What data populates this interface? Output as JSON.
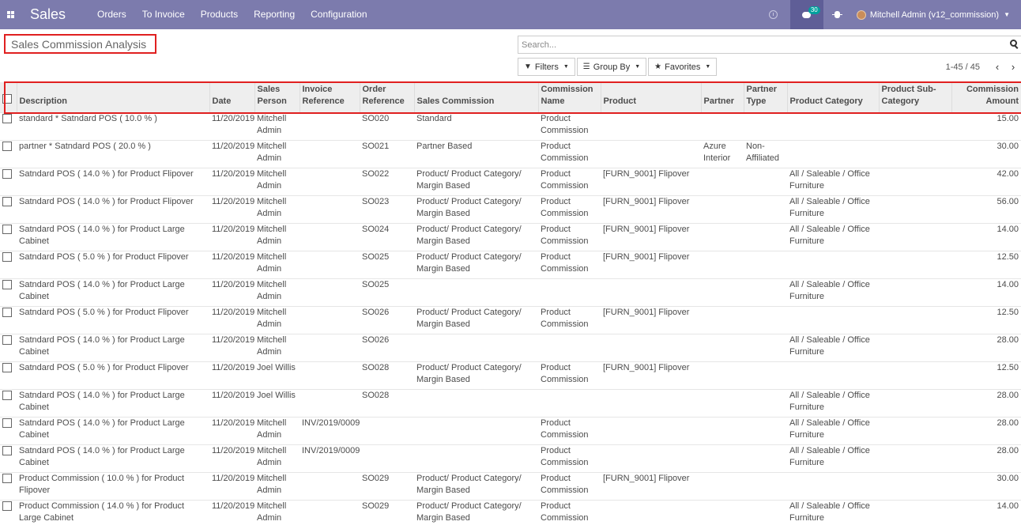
{
  "navbar": {
    "brand": "Sales",
    "menu": [
      "Orders",
      "To Invoice",
      "Products",
      "Reporting",
      "Configuration"
    ],
    "messages_badge": "30",
    "user": "Mitchell Admin (v12_commission)"
  },
  "page": {
    "title": "Sales Commission Analysis",
    "search_placeholder": "Search...",
    "filters_label": "Filters",
    "groupby_label": "Group By",
    "favorites_label": "Favorites",
    "pager": "1-45 / 45"
  },
  "table": {
    "columns": [
      "Description",
      "Date",
      "Sales Person",
      "Invoice Reference",
      "Order Reference",
      "Sales Commission",
      "Commission Name",
      "Product",
      "Partner",
      "Partner Type",
      "Product Category",
      "Product Sub-Category",
      "Commission Amount"
    ],
    "rows": [
      {
        "description": "standard * Satndard POS ( 10.0 % )",
        "date": "11/20/2019",
        "salesperson": "Mitchell Admin",
        "invoice": "",
        "order": "SO020",
        "commission": "Standard",
        "name": "Product Commission",
        "product": "",
        "partner": "",
        "partner_type": "",
        "category": "",
        "subcategory": "",
        "amount": "15.00"
      },
      {
        "description": "partner * Satndard POS ( 20.0 % )",
        "date": "11/20/2019",
        "salesperson": "Mitchell Admin",
        "invoice": "",
        "order": "SO021",
        "commission": "Partner Based",
        "name": "Product Commission",
        "product": "",
        "partner": "Azure Interior",
        "partner_type": "Non-Affiliated",
        "category": "",
        "subcategory": "",
        "amount": "30.00"
      },
      {
        "description": "Satndard POS ( 14.0 % ) for Product Flipover",
        "date": "11/20/2019",
        "salesperson": "Mitchell Admin",
        "invoice": "",
        "order": "SO022",
        "commission": "Product/ Product Category/ Margin Based",
        "name": "Product Commission",
        "product": "[FURN_9001] Flipover",
        "partner": "",
        "partner_type": "",
        "category": "All / Saleable / Office Furniture",
        "subcategory": "",
        "amount": "42.00"
      },
      {
        "description": "Satndard POS ( 14.0 % ) for Product Flipover",
        "date": "11/20/2019",
        "salesperson": "Mitchell Admin",
        "invoice": "",
        "order": "SO023",
        "commission": "Product/ Product Category/ Margin Based",
        "name": "Product Commission",
        "product": "[FURN_9001] Flipover",
        "partner": "",
        "partner_type": "",
        "category": "All / Saleable / Office Furniture",
        "subcategory": "",
        "amount": "56.00"
      },
      {
        "description": "Satndard POS ( 14.0 % ) for Product Large Cabinet",
        "date": "11/20/2019",
        "salesperson": "Mitchell Admin",
        "invoice": "",
        "order": "SO024",
        "commission": "Product/ Product Category/ Margin Based",
        "name": "Product Commission",
        "product": "[FURN_9001] Flipover",
        "partner": "",
        "partner_type": "",
        "category": "All / Saleable / Office Furniture",
        "subcategory": "",
        "amount": "14.00"
      },
      {
        "description": "Satndard POS ( 5.0 % ) for Product Flipover",
        "date": "11/20/2019",
        "salesperson": "Mitchell Admin",
        "invoice": "",
        "order": "SO025",
        "commission": "Product/ Product Category/ Margin Based",
        "name": "Product Commission",
        "product": "[FURN_9001] Flipover",
        "partner": "",
        "partner_type": "",
        "category": "",
        "subcategory": "",
        "amount": "12.50"
      },
      {
        "description": "Satndard POS ( 14.0 % ) for Product Large Cabinet",
        "date": "11/20/2019",
        "salesperson": "Mitchell Admin",
        "invoice": "",
        "order": "SO025",
        "commission": "",
        "name": "",
        "product": "",
        "partner": "",
        "partner_type": "",
        "category": "All / Saleable / Office Furniture",
        "subcategory": "",
        "amount": "14.00"
      },
      {
        "description": "Satndard POS ( 5.0 % ) for Product Flipover",
        "date": "11/20/2019",
        "salesperson": "Mitchell Admin",
        "invoice": "",
        "order": "SO026",
        "commission": "Product/ Product Category/ Margin Based",
        "name": "Product Commission",
        "product": "[FURN_9001] Flipover",
        "partner": "",
        "partner_type": "",
        "category": "",
        "subcategory": "",
        "amount": "12.50"
      },
      {
        "description": "Satndard POS ( 14.0 % ) for Product Large Cabinet",
        "date": "11/20/2019",
        "salesperson": "Mitchell Admin",
        "invoice": "",
        "order": "SO026",
        "commission": "",
        "name": "",
        "product": "",
        "partner": "",
        "partner_type": "",
        "category": "All / Saleable / Office Furniture",
        "subcategory": "",
        "amount": "28.00"
      },
      {
        "description": "Satndard POS ( 5.0 % ) for Product Flipover",
        "date": "11/20/2019",
        "salesperson": "Joel Willis",
        "invoice": "",
        "order": "SO028",
        "commission": "Product/ Product Category/ Margin Based",
        "name": "Product Commission",
        "product": "[FURN_9001] Flipover",
        "partner": "",
        "partner_type": "",
        "category": "",
        "subcategory": "",
        "amount": "12.50"
      },
      {
        "description": "Satndard POS ( 14.0 % ) for Product Large Cabinet",
        "date": "11/20/2019",
        "salesperson": "Joel Willis",
        "invoice": "",
        "order": "SO028",
        "commission": "",
        "name": "",
        "product": "",
        "partner": "",
        "partner_type": "",
        "category": "All / Saleable / Office Furniture",
        "subcategory": "",
        "amount": "28.00"
      },
      {
        "description": "Satndard POS ( 14.0 % ) for Product Large Cabinet",
        "date": "11/20/2019",
        "salesperson": "Mitchell Admin",
        "invoice": "INV/2019/0009",
        "order": "",
        "commission": "",
        "name": "Product Commission",
        "product": "",
        "partner": "",
        "partner_type": "",
        "category": "All / Saleable / Office Furniture",
        "subcategory": "",
        "amount": "28.00"
      },
      {
        "description": "Satndard POS ( 14.0 % ) for Product Large Cabinet",
        "date": "11/20/2019",
        "salesperson": "Mitchell Admin",
        "invoice": "INV/2019/0009",
        "order": "",
        "commission": "",
        "name": "Product Commission",
        "product": "",
        "partner": "",
        "partner_type": "",
        "category": "All / Saleable / Office Furniture",
        "subcategory": "",
        "amount": "28.00"
      },
      {
        "description": "Product Commission ( 10.0 % ) for Product Flipover",
        "date": "11/20/2019",
        "salesperson": "Mitchell Admin",
        "invoice": "",
        "order": "SO029",
        "commission": "Product/ Product Category/ Margin Based",
        "name": "Product Commission",
        "product": "[FURN_9001] Flipover",
        "partner": "",
        "partner_type": "",
        "category": "",
        "subcategory": "",
        "amount": "30.00"
      },
      {
        "description": "Product Commission ( 14.0 % ) for Product Large Cabinet",
        "date": "11/20/2019",
        "salesperson": "Mitchell Admin",
        "invoice": "",
        "order": "SO029",
        "commission": "Product/ Product Category/ Margin Based",
        "name": "Product Commission",
        "product": "",
        "partner": "",
        "partner_type": "",
        "category": "All / Saleable / Office Furniture",
        "subcategory": "",
        "amount": "14.00"
      }
    ]
  },
  "colors": {
    "navbar": "#7c7bad",
    "navbar_active": "#5f5e97",
    "badge": "#00a09d",
    "highlight_outline": "#e02020",
    "header_bg": "#eeeeee"
  }
}
